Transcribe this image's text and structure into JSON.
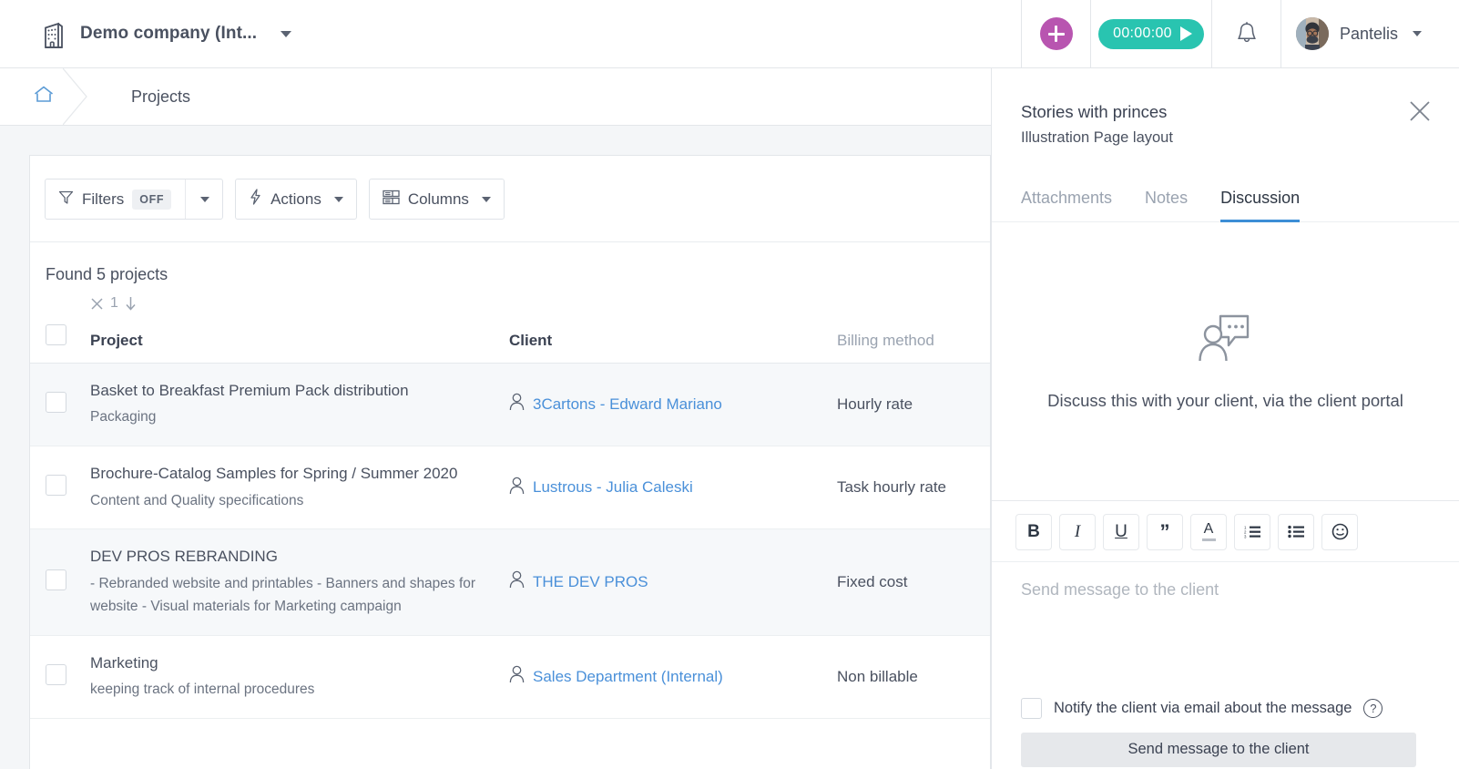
{
  "topbar": {
    "company_name": "Demo company (Int...",
    "building_icon": "building-icon",
    "plus_label": "+",
    "timer_value": "00:00:00",
    "bell_icon": "bell-icon",
    "username": "Pantelis",
    "teal": "#29c4b0",
    "magenta": "#b855b0"
  },
  "breadcrumb": {
    "home_icon": "home-icon",
    "current": "Projects"
  },
  "toolbar": {
    "filters_label": "Filters",
    "filters_state": "OFF",
    "actions_label": "Actions",
    "columns_label": "Columns"
  },
  "main": {
    "found_text": "Found 5 projects",
    "sort_count": "1",
    "columns": [
      "Project",
      "Client",
      "Billing method"
    ],
    "rows": [
      {
        "title": "Basket to Breakfast Premium Pack distribution",
        "subtitle": "Packaging",
        "client": "3Cartons - Edward Mariano",
        "billing": "Hourly rate"
      },
      {
        "title": "Brochure-Catalog Samples for Spring / Summer 2020",
        "subtitle": "Content and Quality specifications",
        "client": "Lustrous - Julia Caleski",
        "billing": "Task hourly rate"
      },
      {
        "title": "DEV PROS REBRANDING",
        "subtitle": "- Rebranded website and printables - Banners and shapes for website - Visual materials for Marketing campaign",
        "client": "THE DEV PROS",
        "billing": "Fixed cost"
      },
      {
        "title": "Marketing",
        "subtitle": "keeping track of internal procedures",
        "client": "Sales Department (Internal)",
        "billing": "Non billable"
      }
    ]
  },
  "side_panel": {
    "title": "Stories with princes",
    "subtitle": "Illustration Page layout",
    "close_icon": "close-icon",
    "tabs": [
      {
        "label": "Attachments",
        "active": false
      },
      {
        "label": "Notes",
        "active": false
      },
      {
        "label": "Discussion",
        "active": true
      }
    ],
    "empty_state": {
      "icon": "discussion-icon",
      "text": "Discuss this with your client, via the client portal"
    },
    "format_toolbar": [
      {
        "name": "bold-icon",
        "glyph": "B"
      },
      {
        "name": "italic-icon",
        "glyph": "I"
      },
      {
        "name": "underline-icon",
        "glyph": "U"
      },
      {
        "name": "quote-icon",
        "glyph": "”"
      },
      {
        "name": "text-color-icon",
        "glyph": "A"
      },
      {
        "name": "ordered-list-icon",
        "glyph": ""
      },
      {
        "name": "unordered-list-icon",
        "glyph": ""
      },
      {
        "name": "emoji-icon",
        "glyph": ""
      }
    ],
    "message_placeholder": "Send message to the client",
    "notify_label": "Notify the client via email about the message",
    "help_icon": "question-mark-icon",
    "send_button": "Send message to the client",
    "accent": "#3d8ed6"
  }
}
